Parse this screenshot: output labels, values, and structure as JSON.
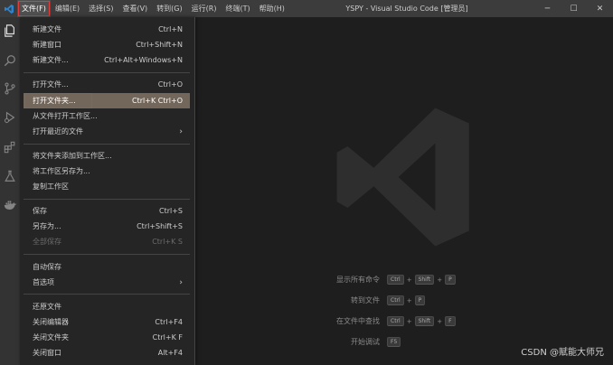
{
  "window": {
    "title": "YSPY - Visual Studio Code [管理员]",
    "controls": [
      "─",
      "☐",
      "✕"
    ]
  },
  "menubar": {
    "items": [
      "文件(F)",
      "编辑(E)",
      "选择(S)",
      "查看(V)",
      "转到(G)",
      "运行(R)",
      "终端(T)",
      "帮助(H)"
    ],
    "active_index": 0
  },
  "activitybar": {
    "icons": [
      "explorer-icon",
      "search-icon",
      "source-control-icon",
      "run-debug-icon",
      "extensions-icon",
      "testing-icon",
      "docker-icon"
    ]
  },
  "file_menu": {
    "items": [
      {
        "label": "新建文件",
        "shortcut": "Ctrl+N"
      },
      {
        "label": "新建窗口",
        "shortcut": "Ctrl+Shift+N"
      },
      {
        "label": "新建文件...",
        "shortcut": "Ctrl+Alt+Windows+N"
      },
      {
        "label": "打开文件...",
        "shortcut": "Ctrl+O"
      },
      {
        "label": "打开文件夹...",
        "shortcut": "Ctrl+K Ctrl+O"
      },
      {
        "label": "从文件打开工作区...",
        "shortcut": ""
      },
      {
        "label": "打开最近的文件",
        "shortcut": "›"
      },
      {
        "label": "将文件夹添加到工作区...",
        "shortcut": ""
      },
      {
        "label": "将工作区另存为...",
        "shortcut": ""
      },
      {
        "label": "复制工作区",
        "shortcut": ""
      },
      {
        "label": "保存",
        "shortcut": "Ctrl+S"
      },
      {
        "label": "另存为...",
        "shortcut": "Ctrl+Shift+S"
      },
      {
        "label": "全部保存",
        "shortcut": "Ctrl+K S"
      },
      {
        "label": "自动保存",
        "shortcut": ""
      },
      {
        "label": "首选项",
        "shortcut": "›"
      },
      {
        "label": "还原文件",
        "shortcut": ""
      },
      {
        "label": "关闭编辑器",
        "shortcut": "Ctrl+F4"
      },
      {
        "label": "关闭文件夹",
        "shortcut": "Ctrl+K F"
      },
      {
        "label": "关闭窗口",
        "shortcut": "Alt+F4"
      }
    ],
    "highlighted_index": 4,
    "disabled_index": 12
  },
  "shortcuts": [
    {
      "label": "显示所有命令",
      "keys": [
        "Ctrl",
        "Shift",
        "P"
      ]
    },
    {
      "label": "转到文件",
      "keys": [
        "Ctrl",
        "P"
      ]
    },
    {
      "label": "在文件中查找",
      "keys": [
        "Ctrl",
        "Shift",
        "F"
      ]
    },
    {
      "label": "开始调试",
      "keys": [
        "F5"
      ]
    }
  ],
  "watermark_text": "CSDN @赋能大师兄",
  "colors": {
    "accent_red": "#e23b3b",
    "highlight": "#73665a",
    "vscode_blue": "#2c84d0"
  }
}
